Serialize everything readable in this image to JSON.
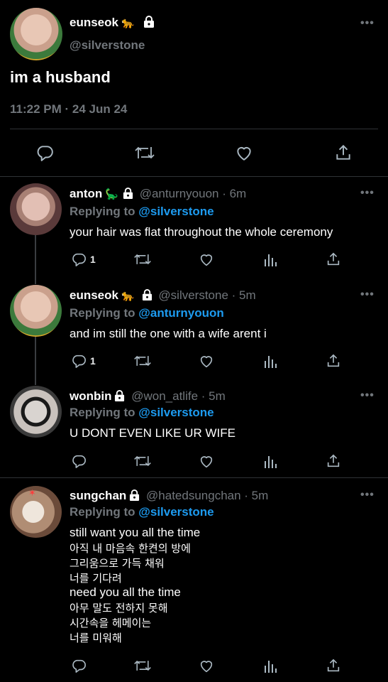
{
  "main_tweet": {
    "display_name": "eunseok",
    "name_emoji": "🐆",
    "handle": "@silverstone",
    "text": "im a husband",
    "meta": "11:22 PM · 24 Jun 24"
  },
  "replies": [
    {
      "display_name": "anton",
      "name_emoji": "🦕",
      "handle": "@anturnyouon",
      "time": "6m",
      "replying_label": "Replying to",
      "replying_to": "@silverstone",
      "lines": [
        "your hair was flat throughout the whole ceremony"
      ],
      "reply_count": "1"
    },
    {
      "display_name": "eunseok",
      "name_emoji": "🐆",
      "handle": "@silverstone",
      "time": "5m",
      "replying_label": "Replying to",
      "replying_to": "@anturnyouon",
      "lines": [
        "and im still the one with a wife arent i"
      ],
      "reply_count": "1"
    },
    {
      "display_name": "wonbin",
      "name_emoji": "",
      "handle": "@won_atlife",
      "time": "5m",
      "replying_label": "Replying to",
      "replying_to": "@silverstone",
      "lines": [
        "U DONT EVEN LIKE UR WIFE"
      ],
      "reply_count": ""
    },
    {
      "display_name": "sungchan",
      "name_emoji": "",
      "handle": "@hatedsungchan",
      "time": "5m",
      "replying_label": "Replying to",
      "replying_to": "@silverstone",
      "lines": [
        "still want you all the time",
        "아직 내 마음속 한켠의 방에",
        "그리움으로 가득 채워",
        "너를 기다려",
        "need you all the time",
        "아무 말도 전하지 못해",
        "시간속을 헤메이는",
        "너를 미워해"
      ],
      "reply_count": ""
    }
  ],
  "colors": {
    "background": "#000000",
    "accent": "#1d9bf0",
    "muted": "#71767b",
    "divider": "#2f3336"
  },
  "icons": [
    "more-icon",
    "lock-icon",
    "reply-icon",
    "retweet-icon",
    "like-icon",
    "analytics-icon",
    "share-icon"
  ]
}
